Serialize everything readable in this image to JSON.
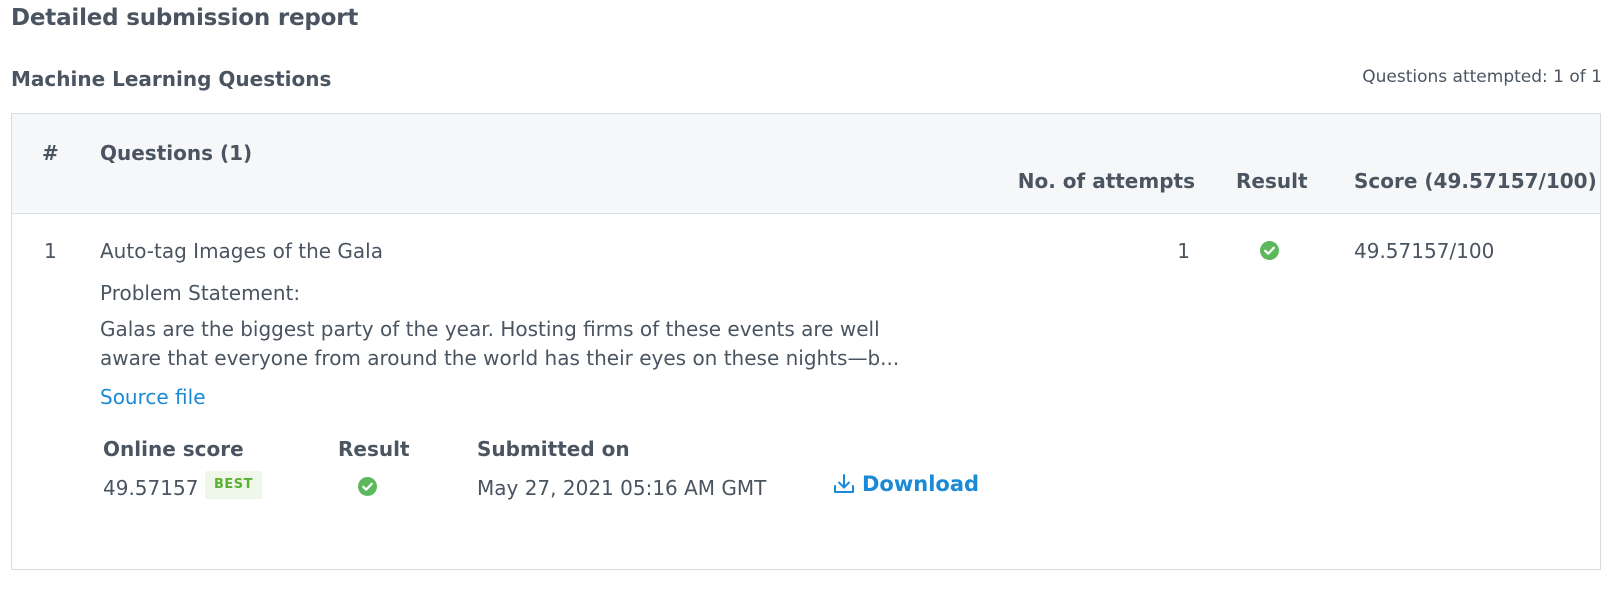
{
  "header": {
    "title": "Detailed submission report"
  },
  "section": {
    "title": "Machine Learning Questions",
    "attempted": "Questions attempted: 1 of 1"
  },
  "table": {
    "columns": {
      "index": "#",
      "questions": "Questions (1)",
      "attempts": "No. of attempts",
      "result": "Result",
      "score": "Score (49.57157/100)"
    },
    "rows": [
      {
        "index": "1",
        "title": "Auto-tag Images of the Gala",
        "statement_label": "Problem Statement:",
        "description": "Galas are the biggest party of the year. Hosting firms of these events are well aware that everyone from around the world has their eyes on these nights—b...",
        "source_link": "Source file",
        "attempts": "1",
        "result_icon": "check-circle-icon",
        "score": "49.57157/100",
        "submission": {
          "headers": {
            "online_score": "Online score",
            "result": "Result",
            "submitted_on": "Submitted on"
          },
          "online_score": "49.57157",
          "badge": "BEST",
          "result_icon": "check-circle-icon",
          "submitted_on": "May 27, 2021 05:16 AM GMT",
          "download_label": "Download",
          "download_icon": "download-icon"
        }
      }
    ]
  },
  "colors": {
    "text": "#4a5561",
    "link": "#1b8ad6",
    "success": "#5cb85c",
    "badge_bg": "#eef7e8",
    "badge_text": "#5ab033",
    "header_bg": "#f6f7f8"
  }
}
